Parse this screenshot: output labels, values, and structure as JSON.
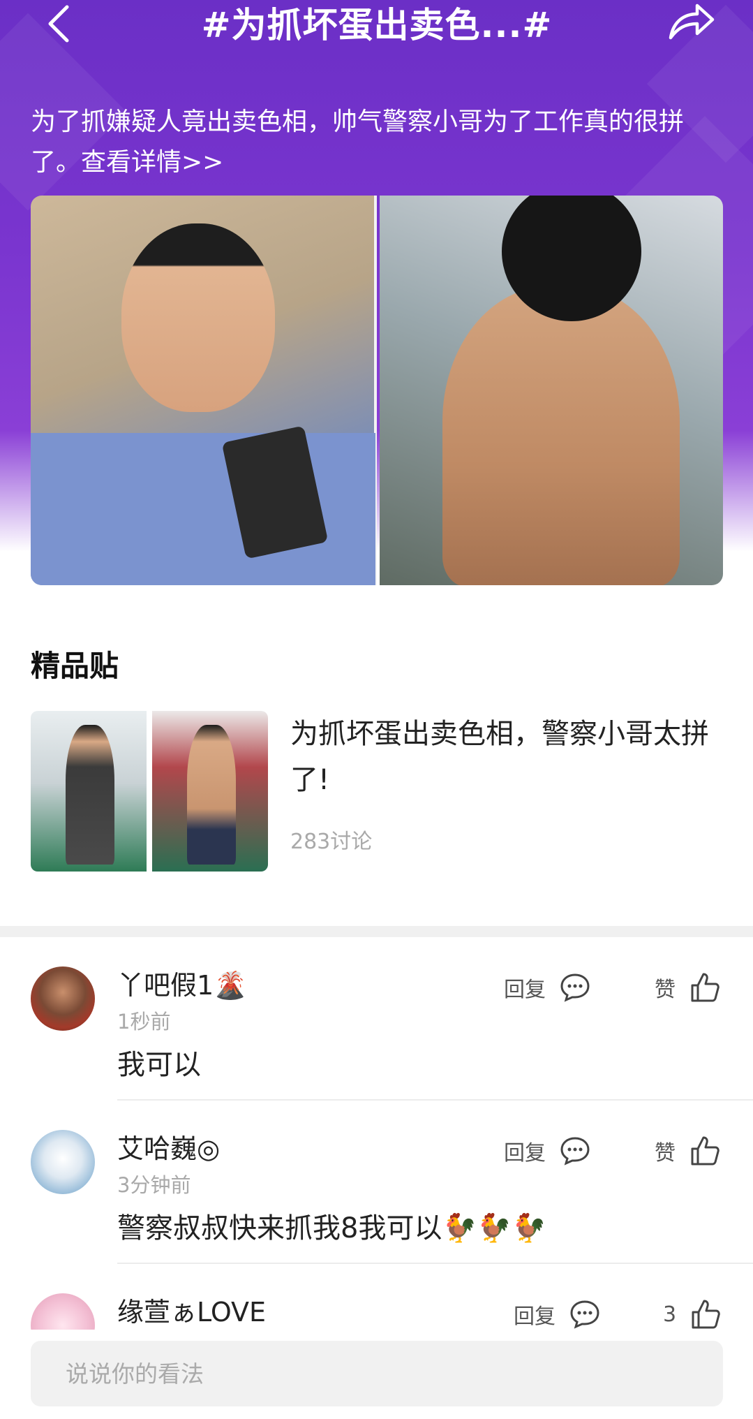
{
  "header": {
    "title": "#为抓坏蛋出卖色...#",
    "description": "为了抓嫌疑人竟出卖色相，帅气警察小哥为了工作真的很拼了。查看详情>>"
  },
  "section": {
    "title": "精品贴"
  },
  "featured_post": {
    "title": "为抓坏蛋出卖色相，警察小哥太拼了!",
    "meta": "283讨论"
  },
  "comments": [
    {
      "username": "丫吧假1🌋",
      "time": "1秒前",
      "text": "我可以",
      "reply_label": "回复",
      "like_label": "赞"
    },
    {
      "username": "艾哈巍◎",
      "time": "3分钟前",
      "text": "警察叔叔快来抓我8我可以🐓🐓🐓",
      "reply_label": "回复",
      "like_label": "赞"
    },
    {
      "username": "缘萱ぁLOVE",
      "time": "",
      "text": "",
      "reply_label": "回复",
      "like_label": "3"
    }
  ],
  "input": {
    "placeholder": "说说你的看法"
  },
  "colors": {
    "hero_purple": "#6b2fc6",
    "hero_purple_light": "#8a3fd6",
    "meta_gray": "#a9a9a9"
  },
  "icons": [
    "back-arrow-icon",
    "share-icon",
    "comment-bubble-icon",
    "thumbs-up-icon"
  ]
}
